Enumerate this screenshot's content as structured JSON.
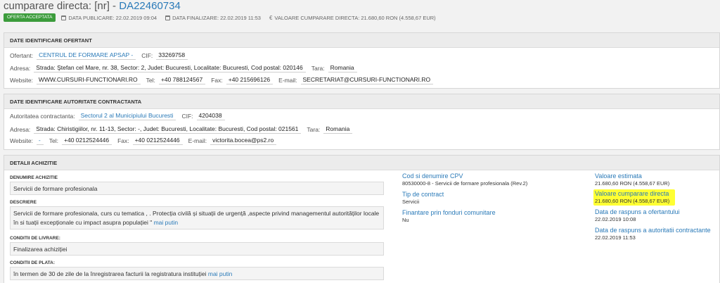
{
  "header": {
    "title_prefix": "cumparare directa: [nr] - ",
    "title_code": "DA22460734",
    "status_badge": "OFERTA ACCEPTATA",
    "publish_date": "DATA PUBLICARE: 22.02.2019 09:04",
    "finalize_date": "DATA FINALIZARE: 22.02.2019 11:53",
    "direct_value": "VALOARE CUMPARARE DIRECTA: 21.680,60  RON (4.558,67  EUR)",
    "icons": [
      "calendar-icon",
      "calendar-icon",
      "euro-icon"
    ]
  },
  "offerer": {
    "heading": "DATE IDENTIFICARE OFERTANT",
    "offerer_label": "Ofertant:",
    "offerer_value": "CENTRUL DE FORMARE APSAP -",
    "cif_label": "CIF:",
    "cif_value": "33269758",
    "address_label": "Adresa:",
    "address_value": "Strada: Ştefan cel Mare, nr. 38, Sector: 2, Judet: Bucuresti, Localitate: Bucuresti, Cod postal: 020146",
    "country_label": "Tara:",
    "country_value": "Romania",
    "website_label": "Website:",
    "website_value": "WWW.CURSURI-FUNCTIONARI.RO",
    "tel_label": "Tel:",
    "tel_value": "+40 788124567",
    "fax_label": "Fax:",
    "fax_value": "+40 215696126",
    "email_label": "E-mail:",
    "email_value": "SECRETARIAT@CURSURI-FUNCTIONARI.RO"
  },
  "authority": {
    "heading": "DATE IDENTIFICARE AUTORITATE CONTRACTANTA",
    "authority_label": "Autoritatea contractanta:",
    "authority_value": "Sectorul 2 al Municipiului Bucuresti",
    "cif_label": "CIF:",
    "cif_value": "4204038",
    "address_label": "Adresa:",
    "address_value": "Strada: Chiristigiilor, nr. 11-13, Sector: -, Judet: Bucuresti, Localitate: Bucuresti, Cod postal: 021561",
    "country_label": "Tara:",
    "country_value": "Romania",
    "website_label": "Website:",
    "website_value": "-",
    "tel_label": "Tel:",
    "tel_value": "+40 0212524446",
    "fax_label": "Fax:",
    "fax_value": "+40 0212524446",
    "email_label": "E-mail:",
    "email_value": "victorita.bocea@ps2.ro"
  },
  "details": {
    "heading": "DETALII ACHIZITIE",
    "name_label": "DENUMIRE ACHIZITIE",
    "name_value": "Servicii de formare profesionala",
    "desc_label": "DESCRIERE",
    "desc_value": "Servicii de formare profesionala, curs cu tematica , . Protecția civilă și situații de urgență ,aspecte privind managementul autorităților locale în si tuații excepționale cu impact asupra populației \" ",
    "delivery_label": "CONDITII DE LIVRARE:",
    "delivery_value": "Finalizarea achiziției",
    "payment_label": "CONDITII DE PLATA:",
    "payment_value": "în termen de 30 de zile de la înregistrarea facturii la registratura instituției ",
    "more_link": "mai putin",
    "cpv_label": "Cod si denumire CPV",
    "cpv_value": "80530000-8 - Servicii de formare profesionala (Rev.2)",
    "contract_type_label": "Tip de contract",
    "contract_type_value": "Servicii",
    "eu_funds_label": "Finantare prin fonduri comunitare",
    "eu_funds_value": "Nu",
    "estimated_label": "Valoare estimata",
    "estimated_value": "21.680,60  RON (4.558,67  EUR)",
    "direct_label": "Valoare cumparare directa",
    "direct_value": "21.680,60  RON (4.558,67  EUR)",
    "offerer_answer_label": "Data de raspuns a ofertantului",
    "offerer_answer_value": "22.02.2019 10:08",
    "authority_answer_label": "Data de raspuns a autoritatii contractante",
    "authority_answer_value": "22.02.2019 11:53"
  },
  "colors": {
    "link": "#2a7ab8",
    "badge": "#3c9c3c",
    "highlight": "#ffff33"
  }
}
